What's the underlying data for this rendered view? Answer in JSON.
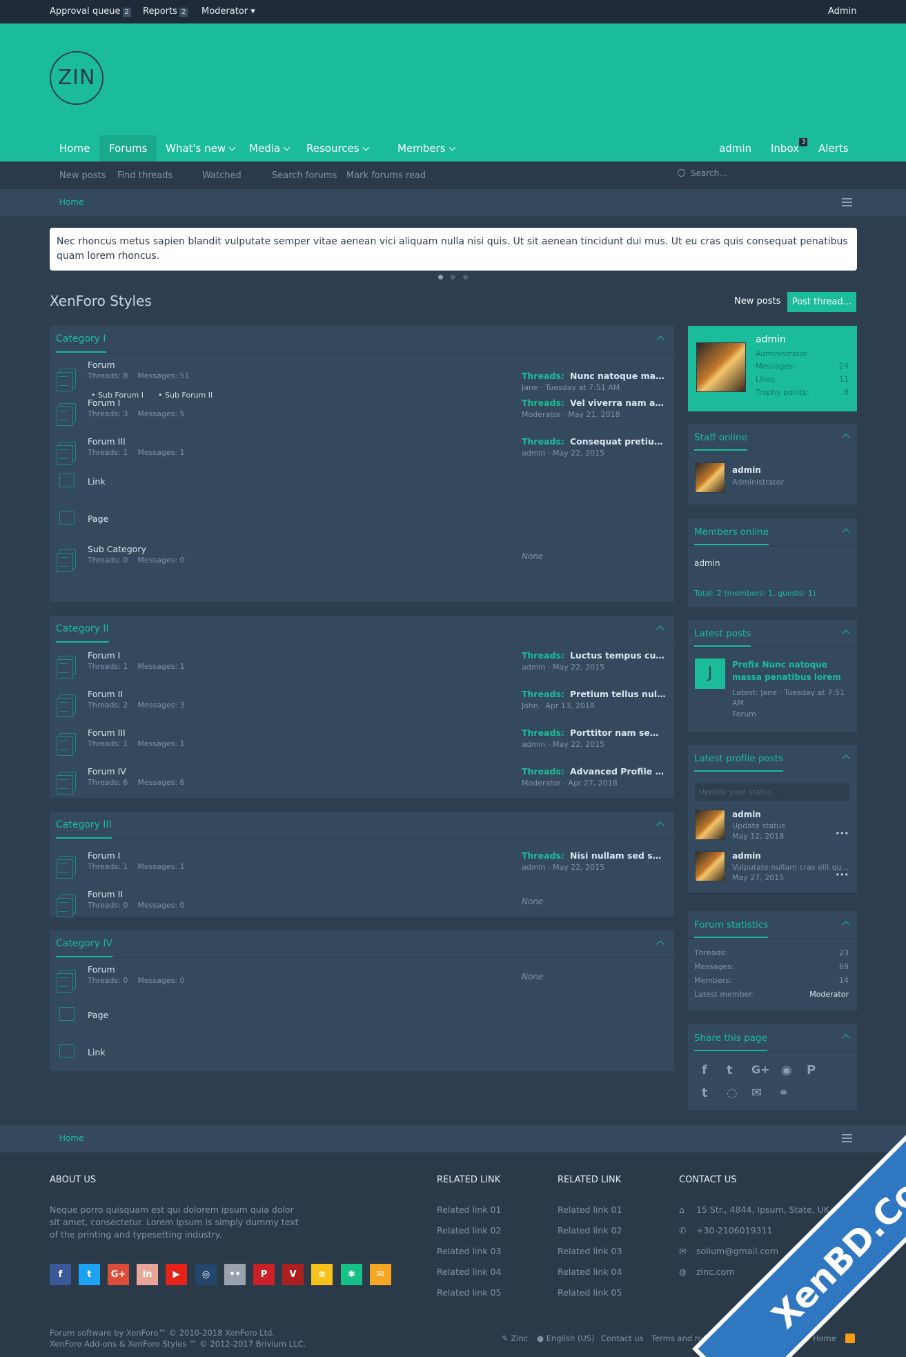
{
  "topbar": {
    "approval_label": "Approval queue",
    "approval_count": "2",
    "reports_label": "Reports",
    "reports_count": "2",
    "moderator_label": "Moderator ▾",
    "admin_label": "Admin"
  },
  "header": {
    "logo_text": "ZIN",
    "nav": [
      "Home",
      "Forums",
      "What's new",
      "Media",
      "Resources",
      "Members"
    ],
    "user": "admin",
    "inbox": "Inbox",
    "inbox_count": "3",
    "alerts": "Alerts"
  },
  "subnav": {
    "links": [
      "New posts",
      "Find threads",
      "Watched",
      "Search forums",
      "Mark forums read"
    ],
    "search_placeholder": "Search..."
  },
  "breadcrumb": "Home",
  "notice": "Nec rhoncus metus sapien blandit vulputate semper vitae aenean vici aliquam nulla nisi quis. Ut sit aenean tincidunt dui mus. Ut eu cras quis consequat penatibus quam lorem rhoncus.",
  "page": {
    "title": "XenForo Styles",
    "new_posts": "New posts",
    "post_thread": "Post thread..."
  },
  "categories": [
    {
      "title": "Category I",
      "nodes": [
        {
          "title": "Forum",
          "threads": "Threads: 8",
          "messages": "Messages: 51",
          "lp_label": "Threads:",
          "lp_title": "Nunc natoque massa...",
          "lp_meta": "Jane · Tuesday at 7:51 AM",
          "subforums": [
            "Sub Forum I",
            "Sub Forum II"
          ]
        },
        {
          "title": "Forum I",
          "threads": "Threads: 3",
          "messages": "Messages: 5",
          "lp_label": "Threads:",
          "lp_title": "Vel viverra nam ante...",
          "lp_meta": "Moderator · May 21, 2018"
        },
        {
          "title": "Forum III",
          "threads": "Threads: 1",
          "messages": "Messages: 1",
          "lp_label": "Threads:",
          "lp_title": "Consequat pretium ...",
          "lp_meta": "admin · May 22, 2015"
        },
        {
          "title": "Link"
        },
        {
          "title": "Page"
        },
        {
          "title": "Sub Category",
          "threads": "Threads: 0",
          "messages": "Messages: 0",
          "none": "None"
        }
      ]
    },
    {
      "title": "Category II",
      "nodes": [
        {
          "title": "Forum I",
          "threads": "Threads: 1",
          "messages": "Messages: 1",
          "lp_label": "Threads:",
          "lp_title": "Luctus tempus cura...",
          "lp_meta": "admin · May 22, 2015"
        },
        {
          "title": "Forum II",
          "threads": "Threads: 2",
          "messages": "Messages: 3",
          "lp_label": "Threads:",
          "lp_title": "Pretium tellus nulla ...",
          "lp_meta": "John · Apr 13, 2018"
        },
        {
          "title": "Forum III",
          "threads": "Threads: 1",
          "messages": "Messages: 1",
          "lp_label": "Threads:",
          "lp_title": "Porttitor nam sem n...",
          "lp_meta": "admin · May 22, 2015"
        },
        {
          "title": "Forum IV",
          "threads": "Threads: 6",
          "messages": "Messages: 6",
          "lp_label": "Threads:",
          "lp_title": "Advanced Profile Post",
          "lp_meta": "Moderator · Apr 27, 2018"
        }
      ]
    },
    {
      "title": "Category III",
      "nodes": [
        {
          "title": "Forum I",
          "threads": "Threads: 1",
          "messages": "Messages: 1",
          "lp_label": "Threads:",
          "lp_title": "Nisi nullam sed sem ...",
          "lp_meta": "admin · May 22, 2015"
        },
        {
          "title": "Forum II",
          "threads": "Threads: 0",
          "messages": "Messages: 0",
          "none": "None"
        }
      ]
    },
    {
      "title": "Category IV",
      "nodes": [
        {
          "title": "Forum",
          "threads": "Threads: 0",
          "messages": "Messages: 0",
          "none": "None"
        },
        {
          "title": "Page"
        },
        {
          "title": "Link"
        }
      ]
    }
  ],
  "sidebar": {
    "profile": {
      "name": "admin",
      "role": "Administrator",
      "messages_label": "Messages:",
      "messages": "24",
      "likes_label": "Likes:",
      "likes": "11",
      "trophy_label": "Trophy points:",
      "trophy": "8"
    },
    "staff_online": {
      "title": "Staff online",
      "name": "admin",
      "role": "Administrator"
    },
    "members_online": {
      "title": "Members online",
      "name": "admin",
      "total": "Total: 2 (members: 1, guests: 1)"
    },
    "latest_posts": {
      "title": "Latest posts",
      "initial": "J",
      "post_title": "Prefix Nunc natoque massa penatibus lorem",
      "meta": "Latest: Jane · Tuesday at 7:51 AM",
      "forum": "Forum"
    },
    "profile_posts": {
      "title": "Latest profile posts",
      "placeholder": "Update your status...",
      "items": [
        {
          "name": "admin",
          "text": "Update status",
          "date": "May 12, 2018"
        },
        {
          "name": "admin",
          "text": "Vulputate nullam cras elit qu...",
          "date": "May 27, 2015"
        }
      ]
    },
    "stats": {
      "title": "Forum statistics",
      "rows": [
        {
          "label": "Threads:",
          "value": "23"
        },
        {
          "label": "Messages:",
          "value": "69"
        },
        {
          "label": "Members:",
          "value": "14"
        },
        {
          "label": "Latest member:",
          "value": "Moderator"
        }
      ]
    },
    "share": {
      "title": "Share this page"
    }
  },
  "footer": {
    "breadcrumb": "Home",
    "about_title": "ABOUT US",
    "about_text": [
      "Neque porro quisquam est qui dolorem ipsum quia dolor",
      "sit amet, consectetur. Lorem Ipsum is simply dummy text",
      "of the printing and typesetting industry."
    ],
    "related_title": "RELATED LINK",
    "related_links": [
      "Related link 01",
      "Related link 02",
      "Related link 03",
      "Related link 04",
      "Related link 05"
    ],
    "contact_title": "CONTACT US",
    "contact": [
      "15 Str., 4844, Ipsum, State, UK",
      "+30-2106019311",
      "solium@gmail.com",
      "zinc.com"
    ],
    "copyright1": "Forum software by XenForo™ © 2010-2018 XenForo Ltd.",
    "copyright2": "XenForo Add-ons & XenForo Styles ™ © 2012-2017 Brivium LLC.",
    "bottom_links": [
      "Zinc",
      "English (US)",
      "Contact us",
      "Terms and rules",
      "Privacy policy",
      "Help",
      "Home"
    ],
    "socials": [
      "f",
      "t",
      "G+",
      "in",
      "▶",
      "◎",
      "••",
      "P",
      "V",
      "≋",
      "✱",
      "✉"
    ],
    "social_colors": [
      "#3b5998",
      "#1da1f2",
      "#dd4b39",
      "#e8a598",
      "#e62117",
      "#24466b",
      "#99a3ad",
      "#cb2027",
      "#ad1f1f",
      "#f7c21a",
      "#16c187",
      "#f5a623"
    ]
  },
  "watermark": "XenBD.Com"
}
